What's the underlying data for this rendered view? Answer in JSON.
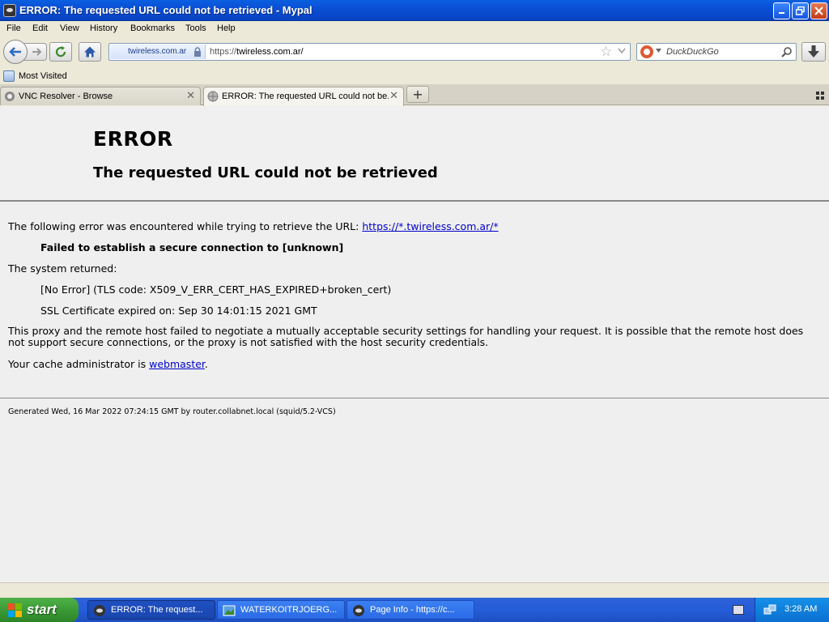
{
  "window": {
    "title": "ERROR: The requested URL could not be retrieved - Mypal"
  },
  "menu": [
    "File",
    "Edit",
    "View",
    "History",
    "Bookmarks",
    "Tools",
    "Help"
  ],
  "navbar": {
    "identity_label": "twireless.com.ar",
    "url_scheme": "https://",
    "url_host": "twireless.com.ar/",
    "search_placeholder": "DuckDuckGo"
  },
  "bookmarks": {
    "most_visited": "Most Visited"
  },
  "tabs": [
    {
      "label": "VNC Resolver - Browse",
      "active": false
    },
    {
      "label": "ERROR: The requested URL could not be...",
      "active": true
    }
  ],
  "page": {
    "heading": "ERROR",
    "subheading": "The requested URL could not be retrieved",
    "encountered_prefix": "The following error was encountered while trying to retrieve the URL: ",
    "encountered_url": "https://*.twireless.com.ar/*",
    "failed": "Failed to establish a secure connection to [unknown]",
    "system_returned": "The system returned:",
    "tls_code": "[No Error] (TLS code: X509_V_ERR_CERT_HAS_EXPIRED+broken_cert)",
    "cert_expired": "SSL Certificate expired on: Sep 30 14:01:15 2021 GMT",
    "negotiation": "This proxy and the remote host failed to negotiate a mutually acceptable security settings for handling your request. It is possible that the remote host does not support secure connections, or the proxy is not satisfied with the host security credentials.",
    "admin_prefix": "Your cache administrator is ",
    "admin_link": "webmaster",
    "admin_suffix": ".",
    "generated": "Generated Wed, 16 Mar 2022 07:24:15 GMT by router.collabnet.local (squid/5.2-VCS)"
  },
  "taskbar": {
    "start": "start",
    "items": [
      {
        "label": "ERROR: The request...",
        "active": true
      },
      {
        "label": "WATERKOITRJOERG...",
        "active": false
      },
      {
        "label": "Page Info - https://c...",
        "active": false
      }
    ],
    "clock": "3:28 AM"
  },
  "colors": {
    "titlebar": "#0a4fd6",
    "link": "#0000cc",
    "taskbar": "#245ed8",
    "start": "#3c9b36"
  }
}
